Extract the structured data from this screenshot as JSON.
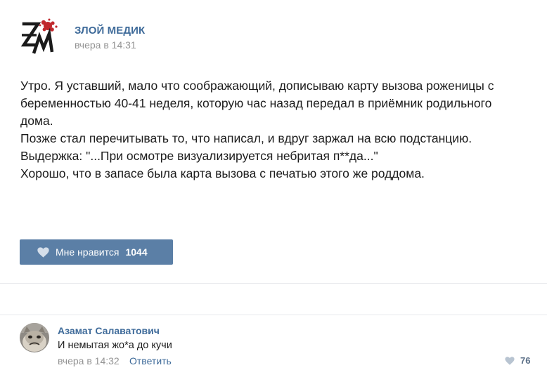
{
  "post": {
    "author": "ЗЛОЙ МЕДИК",
    "time": "вчера в 14:31",
    "lines": [
      "Утро. Я уставший, мало что соображающий, дописываю карту вызова роженицы с",
      "беременностью 40-41 неделя, которую час назад передал в приёмник родильного",
      "дома.",
      "Позже стал перечитывать то, что написал, и вдруг заржал на всю подстанцию.",
      "Выдержка: \"...При осмотре визуализируется небритая п**да...\"",
      "Хорошо, что в запасе была карта вызова с печатью этого же роддома."
    ],
    "like_label": "Мне нравится",
    "like_count": "1044"
  },
  "comment": {
    "author": "Азамат Салаватович",
    "text": "И немытая жо*а до кучи",
    "time": "вчера в 14:32",
    "reply_label": "Ответить",
    "like_count": "76"
  },
  "icons": {
    "logo": "zm-logo-with-red-splat",
    "like": "heart-icon",
    "comment_like": "heart-icon"
  },
  "colors": {
    "link": "#3f6b9a",
    "button": "#5b7fa6",
    "muted": "#939393",
    "logo_red": "#c0282d"
  }
}
